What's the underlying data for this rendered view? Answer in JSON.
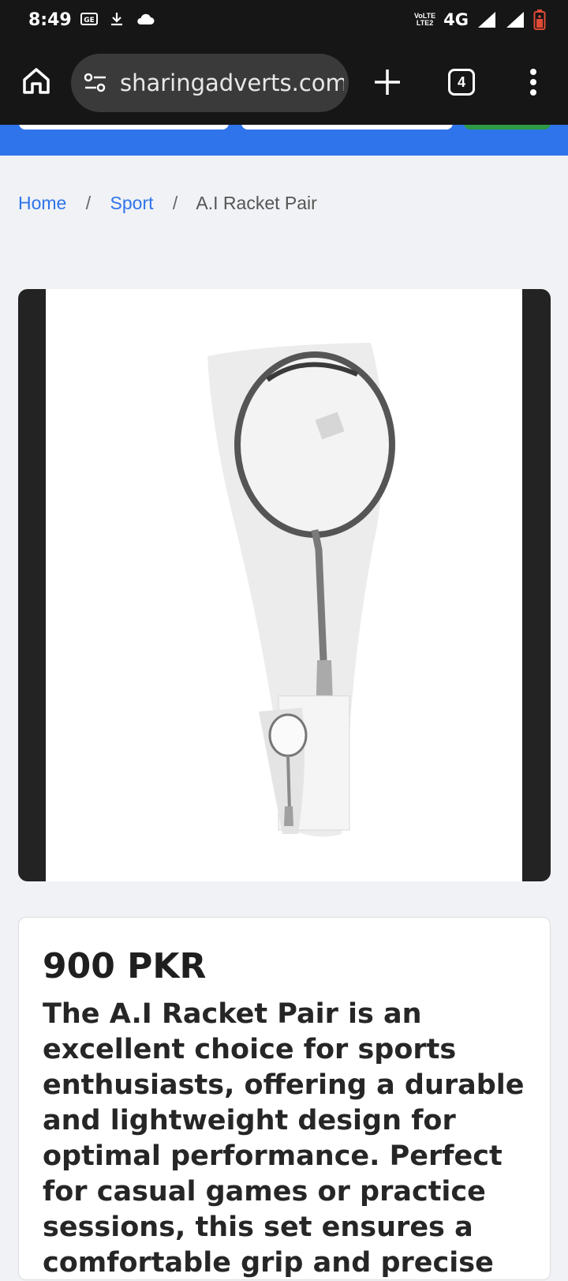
{
  "status_bar": {
    "time": "8:49",
    "network": "4G",
    "volte_top": "VoLTE",
    "volte_bottom": "LTE2",
    "icons": [
      "gallery-icon",
      "download-icon",
      "cloud-icon",
      "signal-icon",
      "battery-icon"
    ]
  },
  "browser": {
    "url": "sharingadverts.com/",
    "tab_count": "4",
    "icons": [
      "home-icon",
      "site-settings-icon",
      "plus-icon",
      "more-vert-icon"
    ]
  },
  "breadcrumb": {
    "home": "Home",
    "sep1": "/",
    "category": "Sport",
    "sep2": "/",
    "current": "A.I Racket Pair"
  },
  "product": {
    "price": "900 PKR",
    "description": "The A.I Racket Pair is an excellent choice for sports enthusiasts, offering a durable and lightweight design for optimal performance. Perfect for casual games or practice sessions, this set ensures a comfortable grip and precise"
  },
  "colors": {
    "accent": "#2f74ea",
    "header_green": "#2e9a46",
    "dark_bar": "#161616"
  }
}
